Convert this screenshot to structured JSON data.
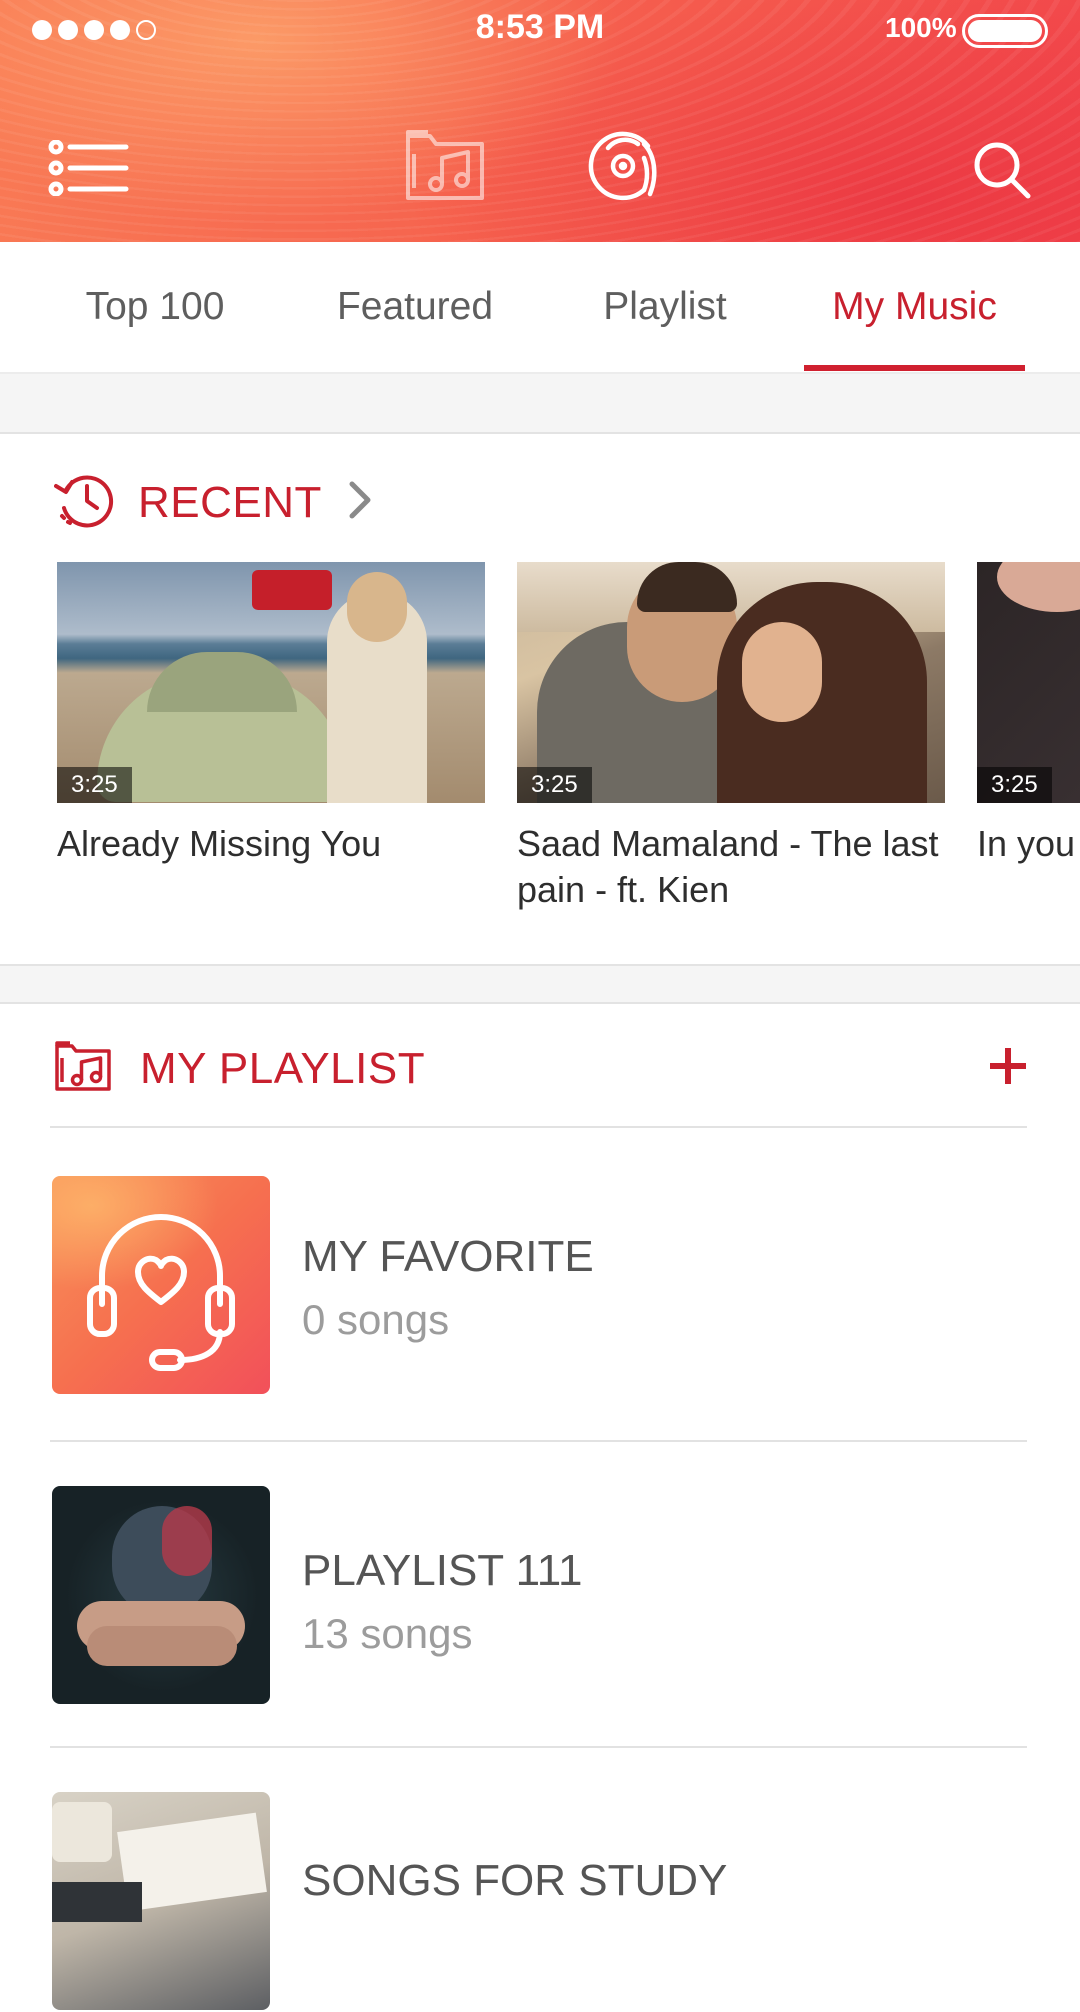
{
  "status_bar": {
    "time": "8:53 PM",
    "battery_percent": "100%",
    "signal_bars": 4,
    "signal_total": 5
  },
  "toolbar": {
    "icons": [
      "menu-list-icon",
      "music-folder-icon",
      "music-disc-icon",
      "search-icon"
    ]
  },
  "tabs": [
    {
      "label": "Top 100"
    },
    {
      "label": "Featured"
    },
    {
      "label": "Playlist"
    },
    {
      "label": "My Music",
      "active": true
    }
  ],
  "recent": {
    "title": "RECENT",
    "items": [
      {
        "title": "Already Missing You",
        "duration": "3:25"
      },
      {
        "title": "Saad Mamaland - The last pain - ft. Kien",
        "duration": "3:25"
      },
      {
        "title": "In you",
        "duration": "3:25"
      }
    ]
  },
  "my_playlist": {
    "title": "MY PLAYLIST",
    "add_label": "+",
    "items": [
      {
        "name": "MY FAVORITE",
        "count": "0 songs"
      },
      {
        "name": "PLAYLIST 111",
        "count": "13 songs"
      },
      {
        "name": "SONGS FOR STUDY",
        "count": ""
      }
    ]
  },
  "colors": {
    "accent": "#c8202e",
    "header_start": "#f97a55",
    "header_end": "#f2474b"
  }
}
